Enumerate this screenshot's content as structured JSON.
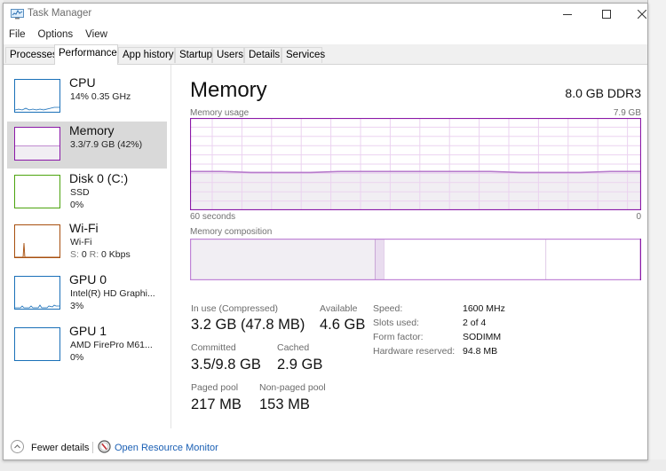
{
  "window": {
    "title": "Task Manager",
    "controls": {
      "minimize": "minimize",
      "maximize": "maximize",
      "close": "close"
    }
  },
  "menu": [
    "File",
    "Options",
    "View"
  ],
  "tabs": [
    {
      "label": "Processes",
      "active": false
    },
    {
      "label": "Performance",
      "active": true
    },
    {
      "label": "App history",
      "active": false
    },
    {
      "label": "Startup",
      "active": false
    },
    {
      "label": "Users",
      "active": false
    },
    {
      "label": "Details",
      "active": false
    },
    {
      "label": "Services",
      "active": false
    }
  ],
  "sidebar": {
    "items": [
      {
        "name": "CPU",
        "line1": "14% 0.35 GHz",
        "line2": "",
        "color": "#1a70b8",
        "selected": false
      },
      {
        "name": "Memory",
        "line1": "3.3/7.9 GB (42%)",
        "line2": "",
        "color": "#8b19a8",
        "selected": true,
        "usage_fraction": 0.42
      },
      {
        "name": "Disk 0 (C:)",
        "line1": "SSD",
        "line2": "0%",
        "color": "#4ca40e",
        "selected": false
      },
      {
        "name": "Wi-Fi",
        "line1": "Wi-Fi",
        "line2_send_label": "S:",
        "line2_send": "0",
        "line2_recv_label": "R:",
        "line2_recv": "0 Kbps",
        "color": "#a74f0e",
        "selected": false
      },
      {
        "name": "GPU 0",
        "line1": "Intel(R) HD Graphi...",
        "line2": "3%",
        "color": "#1a70b8",
        "selected": false
      },
      {
        "name": "GPU 1",
        "line1": "AMD FirePro M61...",
        "line2": "0%",
        "color": "#1a70b8",
        "selected": false
      }
    ]
  },
  "main": {
    "title": "Memory",
    "spec": "8.0 GB DDR3",
    "usage_label": "Memory usage",
    "usage_max": "7.9 GB",
    "time_left": "60 seconds",
    "time_right": "0",
    "composition_label": "Memory composition",
    "accent": "#8b19a8",
    "usage_history_fraction": [
      0.42,
      0.42,
      0.41,
      0.41,
      0.41,
      0.42,
      0.42,
      0.42,
      0.42,
      0.42,
      0.42,
      0.41,
      0.41,
      0.41,
      0.42,
      0.42
    ],
    "composition": {
      "in_use_fraction": 0.41,
      "modified_fraction": 0.02,
      "standby_fraction": 0.36,
      "free_fraction": 0.21
    },
    "stats": {
      "in_use_label": "In use (Compressed)",
      "in_use_value": "3.2 GB (47.8 MB)",
      "available_label": "Available",
      "available_value": "4.6 GB",
      "committed_label": "Committed",
      "committed_value": "3.5/9.8 GB",
      "cached_label": "Cached",
      "cached_value": "2.9 GB",
      "paged_label": "Paged pool",
      "paged_value": "217 MB",
      "nonpaged_label": "Non-paged pool",
      "nonpaged_value": "153 MB"
    },
    "details": [
      {
        "key": "Speed:",
        "value": "1600 MHz"
      },
      {
        "key": "Slots used:",
        "value": "2 of 4"
      },
      {
        "key": "Form factor:",
        "value": "SODIMM"
      },
      {
        "key": "Hardware reserved:",
        "value": "94.8 MB"
      }
    ]
  },
  "footer": {
    "fewer_details": "Fewer details",
    "open_resource_monitor": "Open Resource Monitor"
  }
}
